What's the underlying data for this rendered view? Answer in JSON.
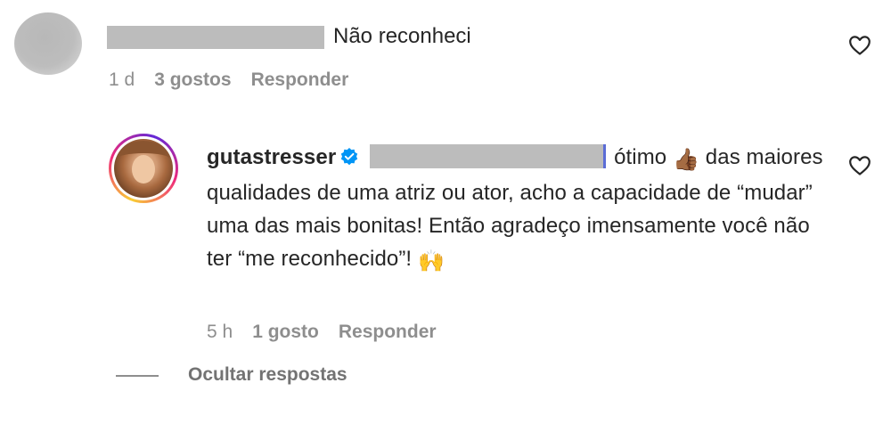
{
  "comment1": {
    "text": "Não reconheci",
    "time": "1 d",
    "likes": "3 gostos",
    "reply_label": "Responder",
    "like_icon": "heart-outline-icon"
  },
  "comment2": {
    "username": "gutastresser",
    "verified_icon": "verified-badge-icon",
    "text_part1": "ótimo",
    "emoji1": "👍🏾",
    "text_part2": "das maiores qualidades de uma atriz ou ator, acho a capacidade de “mudar” uma das mais bonitas! Então agradeço imensamente você não ter “me reconhecido”!",
    "emoji2": "🙌",
    "time": "5 h",
    "likes": "1 gosto",
    "reply_label": "Responder",
    "like_icon": "heart-outline-icon"
  },
  "replies": {
    "hide_label": "Ocultar respostas"
  },
  "colors": {
    "text": "#262626",
    "meta": "#8e8e8e",
    "verified_blue": "#0095f6",
    "redaction": "#bcbcbc"
  }
}
